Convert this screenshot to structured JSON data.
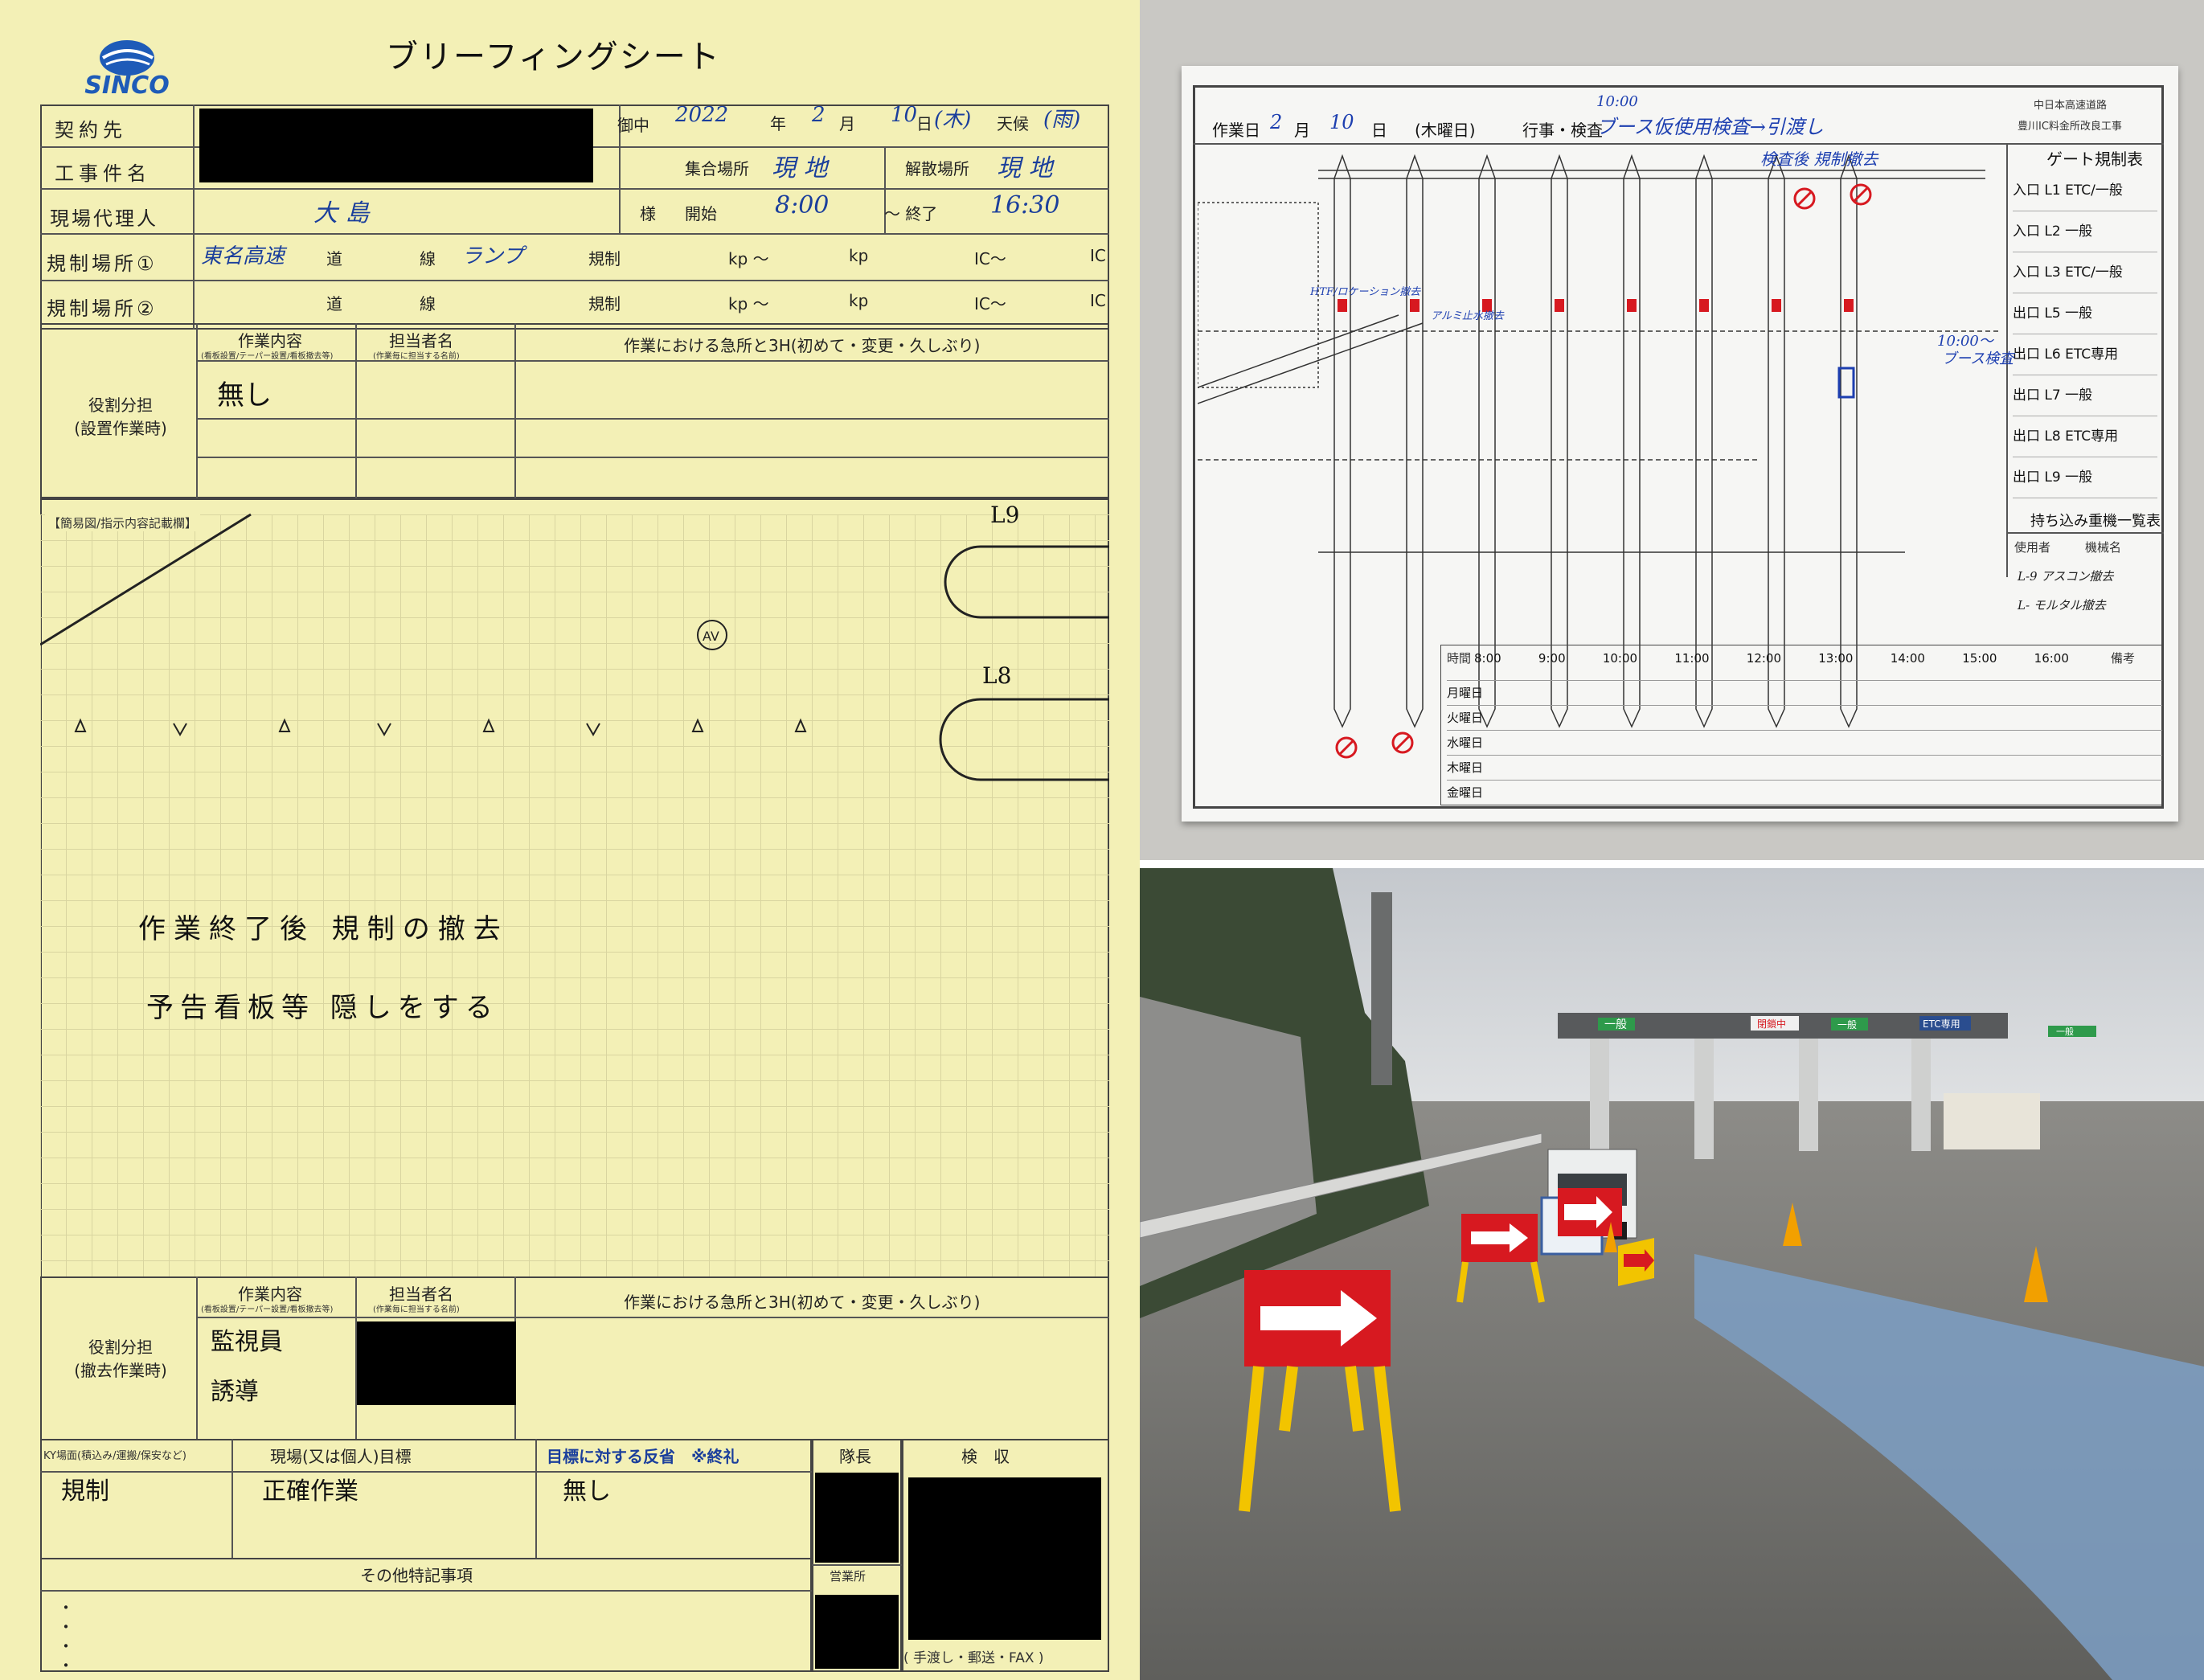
{
  "sheet": {
    "title": "ブリーフィングシート",
    "logo_text": "SINCO",
    "labels": {
      "contractor": "契約先",
      "gochu": "御中",
      "project": "工事件名",
      "site_agent": "現場代理人",
      "sama": "様",
      "reg1": "規制場所①",
      "reg2": "規制場所②",
      "gather_place": "集合場所",
      "disband_place": "解散場所",
      "start": "開始",
      "end": "～ 終了",
      "road": "道",
      "line": "線",
      "kisei": "規制",
      "kp1": "kp ～",
      "kp2": "kp",
      "ic1": "IC～",
      "ic2": "IC",
      "year": "年",
      "month": "月",
      "day": "日",
      "weather": "天候",
      "role_setup": "役割分担\n(設置作業時)",
      "role_remove": "役割分担\n(撤去作業時)",
      "work_content": "作業内容",
      "work_content_sub": "(看板設置/テーパー設置/看板撤去等)",
      "person": "担当者名",
      "person_sub": "(作業毎に担当する名前)",
      "key_points": "作業における急所と3H(初めて・変更・久しぶり)",
      "diagram_label": "【簡易図/指示内容記載欄】",
      "ky": "KY場面(積込み/運搬/保安など)",
      "goal": "現場(又は個人)目標",
      "reflection": "目標に対する反省　※終礼",
      "leader": "隊長",
      "inspection": "検　収",
      "branch": "営業所",
      "other": "その他特記事項",
      "delivery": "( 手渡し・郵送・FAX )"
    },
    "values": {
      "date_year": "2022",
      "date_month": "2",
      "date_day": "10",
      "weekday": "(木)",
      "weather": "(雨)",
      "gather": "現 地",
      "disband": "現 地",
      "agent": "大 島",
      "start_time": "8:00",
      "end_time": "16:30",
      "reg1_road": "東名高速",
      "reg1_line": "ランプ",
      "setup_work": "無し",
      "lane_l9": "L9",
      "lane_l8": "L8",
      "av_mark": "AV",
      "note1": "作業終了後 規制の撤去",
      "note2": "予告看板等 隠しをする",
      "remove_work1": "監視員",
      "remove_work2": "誘導",
      "ky_value": "規制",
      "goal_value": "正確作業",
      "reflection_value": "無し",
      "other_bullets": [
        "・",
        "・",
        "・",
        "・"
      ]
    }
  },
  "board": {
    "work_date_label": "作業日",
    "month": "2",
    "month_unit": "月",
    "day": "10",
    "day_unit": "日",
    "weekday": "(木曜日)",
    "event_label": "行事・検査",
    "event_time": "10:00",
    "event": "ブース仮使用検査→引渡し",
    "header_org1": "中日本高速道路",
    "header_org2": "豊川IC料金所改良工事",
    "gate_title": "ゲート規制表",
    "gates": [
      "入口 L1 ETC/一般",
      "入口 L2 一般",
      "入口 L3 ETC/一般",
      "出口 L5 一般",
      "出口 L6 ETC専用",
      "出口 L7 一般",
      "出口 L8 ETC専用",
      "出口 L9 一般"
    ],
    "equipment_title": "持ち込み重機一覧表",
    "equip_cols": [
      "使用者",
      "機械名"
    ],
    "equip_rows": [
      "L-9 アスコン撤去",
      "L- モルタル撤去"
    ],
    "notes": {
      "after_check": "検査後 規制撤去",
      "time_label": "10:00～",
      "booth_check": "ブース検査",
      "htf": "HTF/ロケーション撤去",
      "tomaru": "アルミ止水撤去"
    },
    "time_header": "時間",
    "time_slots": [
      "8:00",
      "9:00",
      "10:00",
      "11:00",
      "12:00",
      "13:00",
      "14:00",
      "15:00",
      "16:00"
    ],
    "remarks": "備考",
    "weekdays": [
      "月曜日",
      "火曜日",
      "水曜日",
      "木曜日",
      "金曜日"
    ]
  },
  "photo": {
    "sign_general": "一般",
    "sign_etc": "ETC専用",
    "sign_closed": "閉鎖中",
    "sign_r2": "一般"
  },
  "colors": {
    "sheet_bg": "#f3f0b6",
    "handwriting_blue": "#1b3f9c",
    "board_bg": "#f6f6f4",
    "road_blue": "#7d9fc4",
    "arrow_red": "#d71920",
    "barricade_yellow": "#f2c400"
  }
}
